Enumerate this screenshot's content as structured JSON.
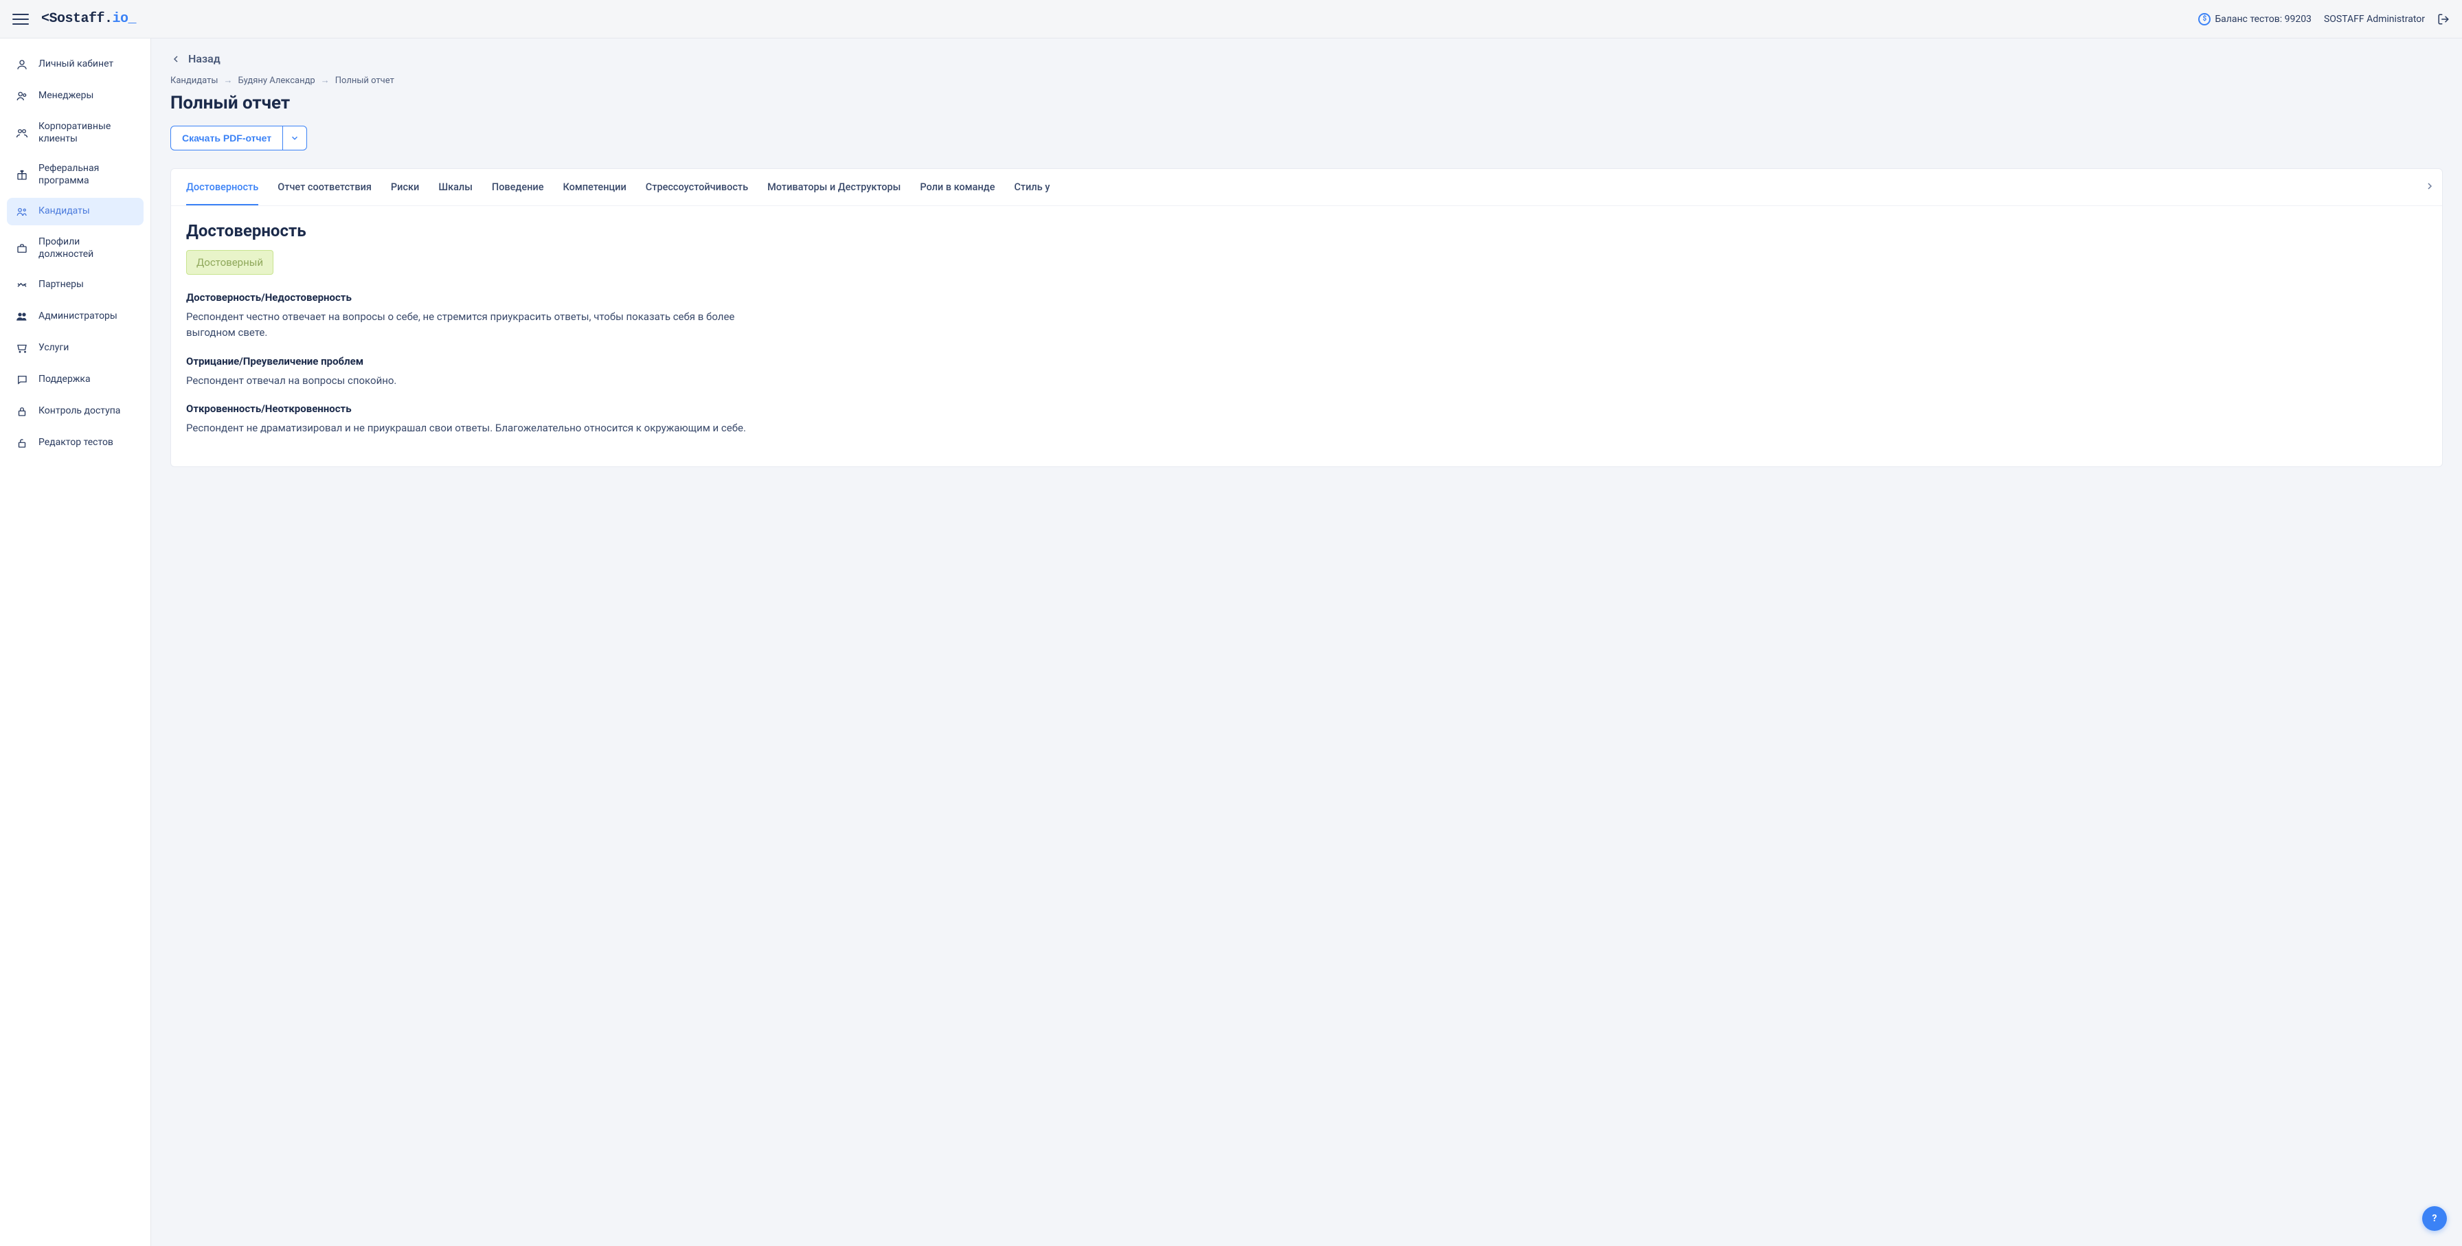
{
  "header": {
    "logo_pre": "<Sostaff.",
    "logo_io": "io",
    "logo_cursor": "_",
    "balance_label": "Баланс тестов: 99203",
    "user_name": "SOSTAFF Administrator"
  },
  "sidebar": {
    "items": [
      {
        "label": "Личный кабинет"
      },
      {
        "label": "Менеджеры"
      },
      {
        "label": "Корпоративные клиенты"
      },
      {
        "label": "Реферальная программа"
      },
      {
        "label": "Кандидаты"
      },
      {
        "label": "Профили должностей"
      },
      {
        "label": "Партнеры"
      },
      {
        "label": "Администраторы"
      },
      {
        "label": "Услуги"
      },
      {
        "label": "Поддержка"
      },
      {
        "label": "Контроль доступа"
      },
      {
        "label": "Редактор тестов"
      }
    ],
    "active_index": 4
  },
  "main": {
    "back": "Назад",
    "breadcrumb": [
      "Кандидаты",
      "Будяну Александр",
      "Полный отчет"
    ],
    "title": "Полный отчет",
    "pdf_button": "Скачать PDF-отчет",
    "tabs": [
      "Достоверность",
      "Отчет соответствия",
      "Риски",
      "Шкалы",
      "Поведение",
      "Компетенции",
      "Стрессоустойчивость",
      "Мотиваторы и Деструкторы",
      "Роли в команде",
      "Стиль у"
    ],
    "active_tab": 0,
    "section": {
      "title": "Достоверность",
      "badge": "Достоверный",
      "blocks": [
        {
          "h": "Достоверность/Недостоверность",
          "p": "Респондент честно отвечает на вопросы о себе, не стремится приукрасить ответы, чтобы показать себя в более выгодном свете."
        },
        {
          "h": "Отрицание/Преувеличение проблем",
          "p": "Респондент отвечал на вопросы спокойно."
        },
        {
          "h": "Откровенность/Неоткровенность",
          "p": "Респондент не драматизировал и не приукрашал свои ответы. Благожелательно относится к окружающим и себе."
        }
      ]
    }
  },
  "help": "?"
}
